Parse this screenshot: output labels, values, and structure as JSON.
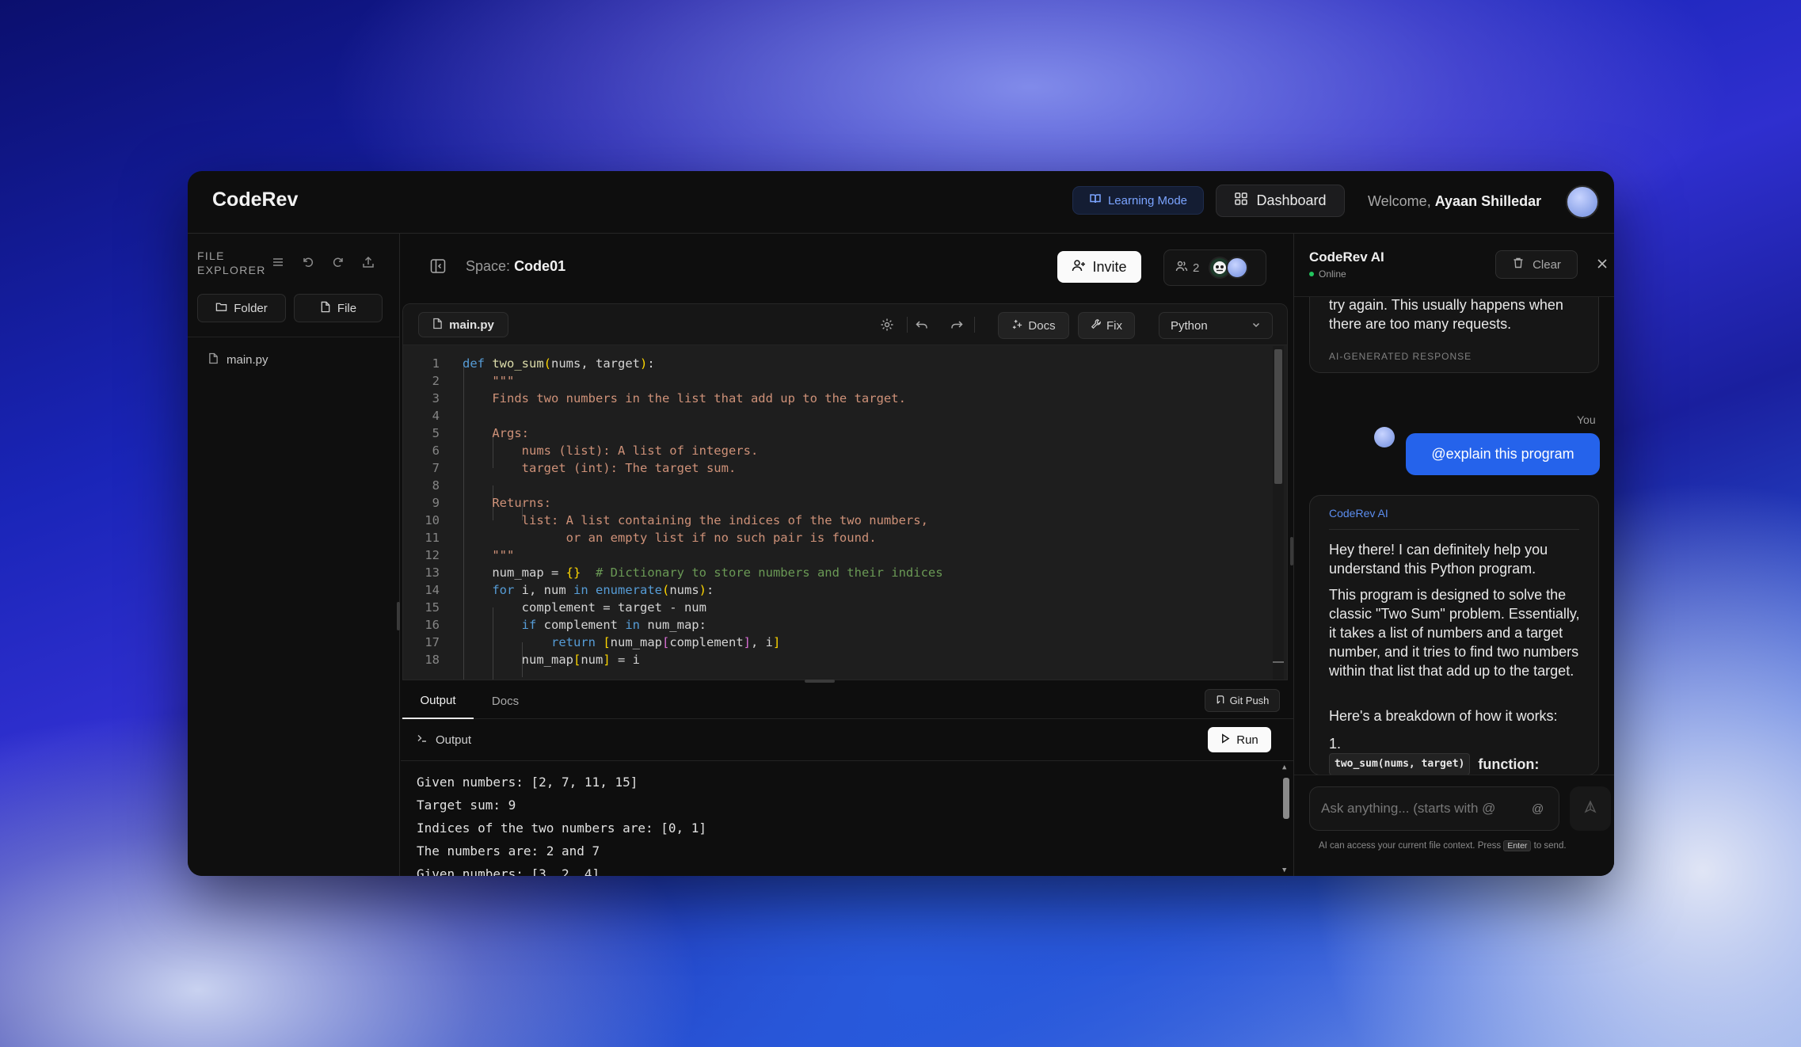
{
  "app": {
    "brand": "CodeRev"
  },
  "topbar": {
    "learning_mode": "Learning Mode",
    "dashboard": "Dashboard",
    "welcome_prefix": "Welcome,",
    "user_name": "Ayaan Shilledar"
  },
  "sidebar": {
    "title_line1": "FILE",
    "title_line2": "EXPLORER",
    "folder_button": "Folder",
    "file_button": "File",
    "files": [
      {
        "name": "main.py"
      }
    ]
  },
  "space": {
    "label": "Space:",
    "name": "Code01",
    "invite": "Invite",
    "user_count": "2"
  },
  "editor": {
    "tab": "main.py",
    "docs": "Docs",
    "fix": "Fix",
    "language": "Python",
    "lines": [
      "1",
      "2",
      "3",
      "4",
      "5",
      "6",
      "7",
      "8",
      "9",
      "10",
      "11",
      "12",
      "13",
      "14",
      "15",
      "16",
      "17",
      "18"
    ]
  },
  "output_panel": {
    "tabs": [
      "Output",
      "Docs"
    ],
    "git_push": "Git Push",
    "header": "Output",
    "run": "Run",
    "console_lines": [
      "Given numbers: [2, 7, 11, 15]",
      "Target sum: 9",
      "Indices of the two numbers are: [0, 1]",
      "The numbers are: 2 and 7",
      "Given numbers: [3, 2, 4]"
    ]
  },
  "ai_panel": {
    "title": "CodeRev AI",
    "status": "Online",
    "clear": "Clear",
    "prev_message": "try again. This usually happens when there are too many requests.",
    "prev_tag": "AI-GENERATED RESPONSE",
    "you_label": "You",
    "user_message": "@explain this program",
    "response_author": "CodeRev AI",
    "response_p1": "Hey there! I can definitely help you understand this Python program.",
    "response_p2": "This program is designed to solve the classic \"Two Sum\" problem. Essentially, it takes a list of numbers and a target number, and it tries to find two numbers within that list that add up to the target.",
    "response_p3": "Here's a breakdown of how it works:",
    "response_list_num": "1.",
    "response_code_chip": "two_sum(nums, target)",
    "response_function_word": "function:",
    "input_placeholder": "Ask anything... (starts with @",
    "at_symbol": "@",
    "hint_prefix": "AI can access your current file context. Press",
    "hint_key": "Enter",
    "hint_suffix": "to send."
  },
  "colors": {
    "accent": "#2563eb",
    "link_blue": "#5b8def",
    "online": "#22c55e",
    "learning_mode_text": "#7ba4ff"
  }
}
